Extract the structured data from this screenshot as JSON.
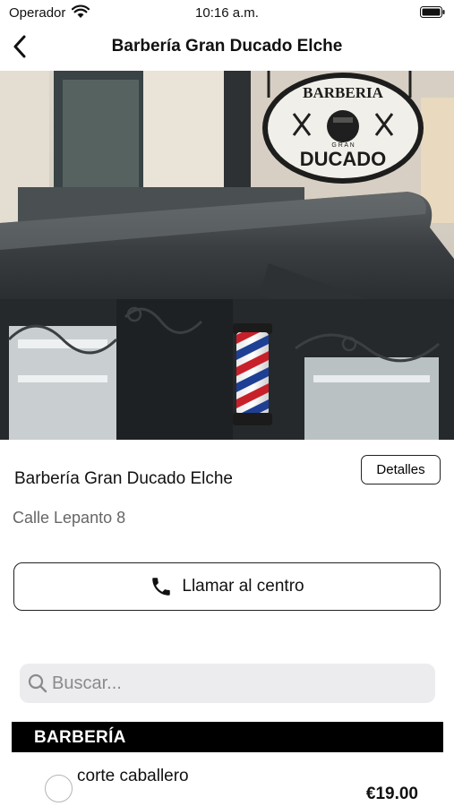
{
  "status_bar": {
    "carrier": "Operador",
    "time": "10:16 a.m."
  },
  "nav": {
    "title": "Barbería Gran Ducado Elche"
  },
  "hero": {
    "sign_top": "BARBERIA",
    "sign_middle": "G R A N",
    "sign_bottom": "DUCADO"
  },
  "shop": {
    "name": "Barbería Gran Ducado Elche",
    "address": "Calle Lepanto 8",
    "details_label": "Detalles",
    "call_label": "Llamar al centro"
  },
  "search": {
    "placeholder": "Buscar..."
  },
  "category": {
    "label": "BARBERÍA"
  },
  "services": [
    {
      "name": "corte caballero",
      "price": "€19.00"
    }
  ]
}
